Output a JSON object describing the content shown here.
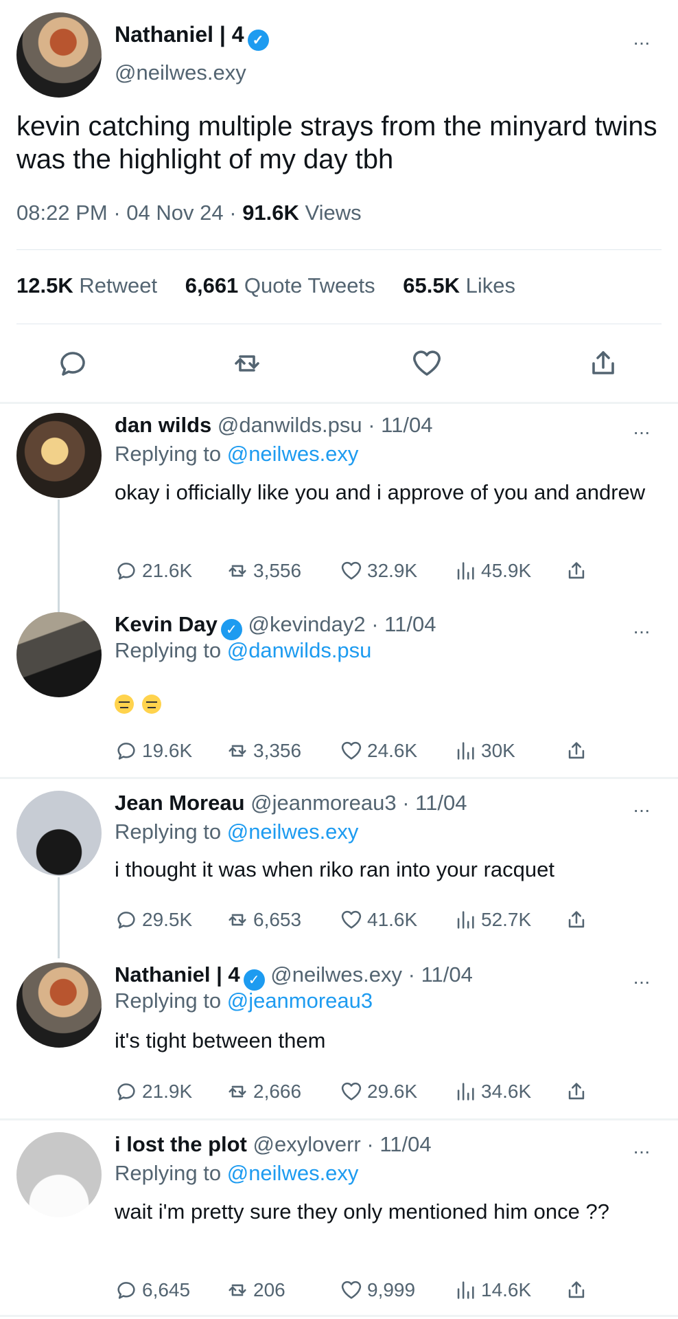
{
  "main_post": {
    "author_name": "Nathaniel | 4",
    "handle": "@neilwes.exy",
    "text": "kevin catching multiple strays from the minyard twins was the highlight of my day tbh",
    "time": "08:22 PM",
    "date": "04 Nov 24",
    "views_count": "91.6K",
    "views_label": "Views",
    "retweets_count": "12.5K",
    "retweets_label": "Retweet",
    "quotes_count": "6,661",
    "quotes_label": "Quote Tweets",
    "likes_count": "65.5K",
    "likes_label": "Likes"
  },
  "replies": [
    {
      "name": "dan wilds",
      "handle": "@danwilds.psu",
      "date": "11/04",
      "reply_to": "@neilwes.exy",
      "text": "okay i officially like you and i approve of you and andrew",
      "stats": [
        "21.6K",
        "3,556",
        "32.9K",
        "45.9K"
      ]
    },
    {
      "name": "Kevin Day",
      "handle": "@kevinday2",
      "date": "11/04",
      "reply_to": "@danwilds.psu",
      "text": "",
      "stats": [
        "19.6K",
        "3,356",
        "24.6K",
        "30K"
      ]
    },
    {
      "name": "Jean Moreau",
      "handle": "@jeanmoreau3",
      "date": "11/04",
      "reply_to": "@neilwes.exy",
      "text": "i thought it was when riko ran into your racquet",
      "stats": [
        "29.5K",
        "6,653",
        "41.6K",
        "52.7K"
      ]
    },
    {
      "name": "Nathaniel | 4",
      "handle": "@neilwes.exy",
      "date": "11/04",
      "reply_to": "@jeanmoreau3",
      "text": "it's tight between them",
      "stats": [
        "21.9K",
        "2,666",
        "29.6K",
        "34.6K"
      ]
    },
    {
      "name": "i lost the plot",
      "handle": "@exyloverr",
      "date": "11/04",
      "reply_to": "@neilwes.exy",
      "text": "wait i'm pretty sure they only mentioned him once ??",
      "stats": [
        "6,645",
        "206",
        "9,999",
        "14.6K"
      ]
    }
  ],
  "labels": {
    "replying_to": "Replying to",
    "more": "···",
    "separator": "·"
  },
  "colors": {
    "accent": "#1d9bf0",
    "muted": "#536471",
    "text": "#0f1419",
    "divider": "#e1e8ed"
  }
}
